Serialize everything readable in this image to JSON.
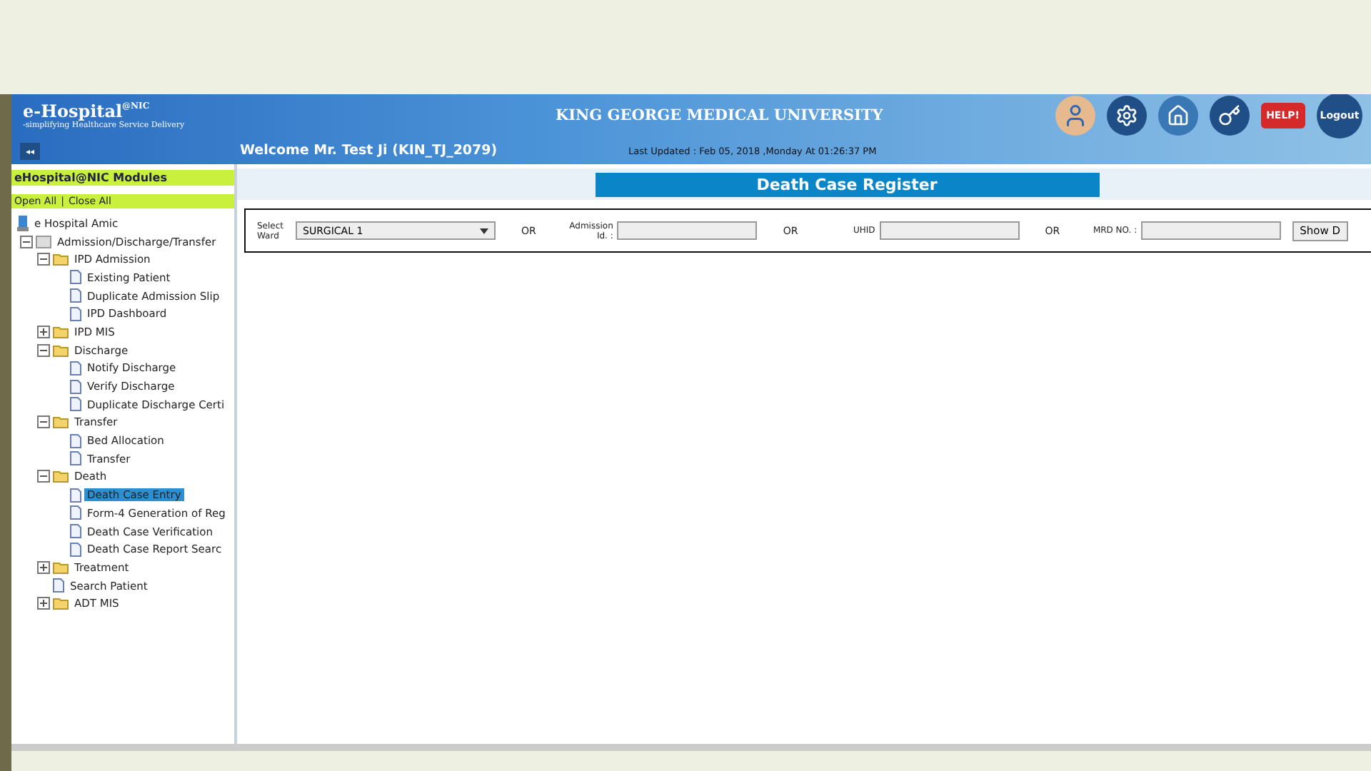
{
  "header": {
    "brand": "e-Hospital",
    "brand_sup": "@NIC",
    "tagline": "-simplifying Healthcare Service Delivery",
    "university": "KING GEORGE MEDICAL UNIVERSITY",
    "welcome": "Welcome Mr. Test Ji (KIN_TJ_2079)",
    "last_updated": "Last Updated : Feb 05, 2018 ,Monday At 01:26:37 PM",
    "collapse": "◂◂",
    "help": "HELP!",
    "logout": "Logout"
  },
  "sidebar": {
    "title": "eHospital@NIC Modules",
    "open_all": "Open All",
    "separator": "|",
    "close_all": "Close All",
    "root": "e Hospital Amic",
    "tree": [
      {
        "label": "Admission/Discharge/Transfer",
        "kind": "module",
        "expanded": true,
        "selected": false,
        "children": [
          {
            "label": "IPD Admission",
            "kind": "folder",
            "expanded": true,
            "selected": false,
            "children": [
              {
                "label": "Existing Patient",
                "kind": "page",
                "selected": false
              },
              {
                "label": "Duplicate Admission Slip",
                "kind": "page",
                "selected": false
              },
              {
                "label": "IPD Dashboard",
                "kind": "page",
                "selected": false
              }
            ]
          },
          {
            "label": "IPD MIS",
            "kind": "folder",
            "expanded": false,
            "selected": false
          },
          {
            "label": "Discharge",
            "kind": "folder",
            "expanded": true,
            "selected": false,
            "children": [
              {
                "label": "Notify Discharge",
                "kind": "page",
                "selected": false
              },
              {
                "label": "Verify Discharge",
                "kind": "page",
                "selected": false
              },
              {
                "label": "Duplicate Discharge Certi",
                "kind": "page",
                "selected": false
              }
            ]
          },
          {
            "label": "Transfer",
            "kind": "folder",
            "expanded": true,
            "selected": false,
            "children": [
              {
                "label": "Bed Allocation",
                "kind": "page",
                "selected": false
              },
              {
                "label": "Transfer",
                "kind": "page",
                "selected": false
              }
            ]
          },
          {
            "label": "Death",
            "kind": "folder",
            "expanded": true,
            "selected": false,
            "children": [
              {
                "label": "Death Case Entry",
                "kind": "page",
                "selected": true
              },
              {
                "label": "Form-4 Generation of Reg",
                "kind": "page",
                "selected": false
              },
              {
                "label": "Death Case Verification",
                "kind": "page",
                "selected": false
              },
              {
                "label": "Death Case Report Searc",
                "kind": "page",
                "selected": false
              }
            ]
          },
          {
            "label": "Treatment",
            "kind": "folder",
            "expanded": false,
            "selected": false
          },
          {
            "label": "Search Patient",
            "kind": "page",
            "selected": false
          },
          {
            "label": "ADT MIS",
            "kind": "folder",
            "expanded": false,
            "selected": false
          }
        ]
      }
    ]
  },
  "content": {
    "title": "Death Case Register",
    "filters": [
      {
        "kind": "select",
        "label": "Select Ward",
        "value": "SURGICAL 1"
      },
      {
        "kind": "or",
        "label": "OR"
      },
      {
        "kind": "input",
        "label": "Admission Id. :"
      },
      {
        "kind": "or",
        "label": "OR"
      },
      {
        "kind": "input",
        "label": "UHID"
      },
      {
        "kind": "or",
        "label": "OR"
      },
      {
        "kind": "input",
        "label": "MRD NO. :"
      },
      {
        "kind": "button",
        "label": "Show D"
      }
    ]
  }
}
